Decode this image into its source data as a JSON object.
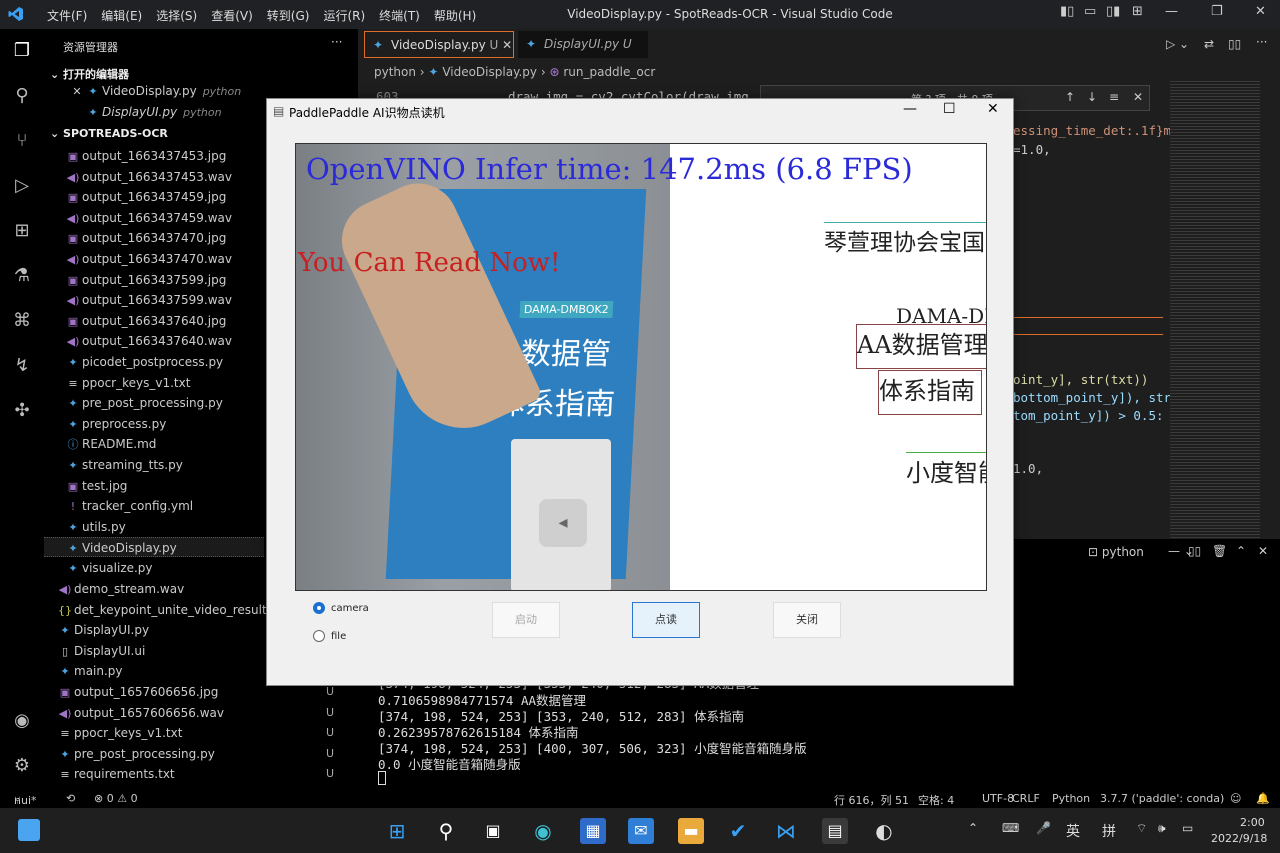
{
  "window": {
    "title": "VideoDisplay.py - SpotReads-OCR - Visual Studio Code",
    "menu": [
      "文件(F)",
      "编辑(E)",
      "选择(S)",
      "查看(V)",
      "转到(G)",
      "运行(R)",
      "终端(T)",
      "帮助(H)"
    ]
  },
  "sidebar": {
    "header": "资源管理器",
    "open_editors_title": "打开的编辑器",
    "open_editors": [
      {
        "name": "VideoDisplay.py",
        "lang": "python"
      },
      {
        "name": "DisplayUI.py",
        "lang": "python"
      }
    ],
    "project_title": "SPOTREADS-OCR",
    "files": [
      {
        "name": "output_1663437453.jpg",
        "icon": "image-icon"
      },
      {
        "name": "output_1663437453.wav",
        "icon": "audio-icon"
      },
      {
        "name": "output_1663437459.jpg",
        "icon": "image-icon"
      },
      {
        "name": "output_1663437459.wav",
        "icon": "audio-icon"
      },
      {
        "name": "output_1663437470.jpg",
        "icon": "image-icon"
      },
      {
        "name": "output_1663437470.wav",
        "icon": "audio-icon"
      },
      {
        "name": "output_1663437599.jpg",
        "icon": "image-icon"
      },
      {
        "name": "output_1663437599.wav",
        "icon": "audio-icon"
      },
      {
        "name": "output_1663437640.jpg",
        "icon": "image-icon"
      },
      {
        "name": "output_1663437640.wav",
        "icon": "audio-icon"
      },
      {
        "name": "picodet_postprocess.py",
        "icon": "python-icon"
      },
      {
        "name": "ppocr_keys_v1.txt",
        "icon": "text-icon"
      },
      {
        "name": "pre_post_processing.py",
        "icon": "python-icon"
      },
      {
        "name": "preprocess.py",
        "icon": "python-icon"
      },
      {
        "name": "README.md",
        "icon": "info-icon"
      },
      {
        "name": "streaming_tts.py",
        "icon": "python-icon"
      },
      {
        "name": "test.jpg",
        "icon": "image-icon"
      },
      {
        "name": "tracker_config.yml",
        "icon": "yaml-icon"
      },
      {
        "name": "utils.py",
        "icon": "python-icon"
      },
      {
        "name": "VideoDisplay.py",
        "icon": "python-icon"
      },
      {
        "name": "visualize.py",
        "icon": "python-icon"
      }
    ],
    "outer_files": [
      {
        "name": "demo_stream.wav",
        "icon": "audio-icon",
        "badge": ""
      },
      {
        "name": "det_keypoint_unite_video_results.json",
        "icon": "json-icon",
        "badge": ""
      },
      {
        "name": "DisplayUI.py",
        "icon": "python-icon",
        "badge": ""
      },
      {
        "name": "DisplayUI.ui",
        "icon": "ui-icon",
        "badge": ""
      },
      {
        "name": "main.py",
        "icon": "python-icon",
        "badge": ""
      },
      {
        "name": "output_1657606656.jpg",
        "icon": "image-icon",
        "badge": "U"
      },
      {
        "name": "output_1657606656.wav",
        "icon": "audio-icon",
        "badge": "U"
      },
      {
        "name": "ppocr_keys_v1.txt",
        "icon": "text-icon",
        "badge": "U"
      },
      {
        "name": "pre_post_processing.py",
        "icon": "python-icon",
        "badge": "U"
      },
      {
        "name": "requirements.txt",
        "icon": "text-icon",
        "badge": "U"
      }
    ]
  },
  "editor": {
    "tabs": [
      {
        "label": "VideoDisplay.py",
        "badge": "U"
      },
      {
        "label": "DisplayUI.py",
        "badge": "U"
      }
    ],
    "breadcrumb": [
      "python",
      "VideoDisplay.py",
      "run_paddle_ocr"
    ],
    "find_result": "第 ? 项，共 0 项",
    "code_lines": [
      {
        "num": "603",
        "text": "draw_img = cv2.cvtColor(draw_img,"
      },
      {
        "num": "",
        "text": "essing_time_det:.1f}m"
      },
      {
        "num": "",
        "text": "=1.0,"
      },
      {
        "num": "",
        "text": "oint_y], str(txt))"
      },
      {
        "num": "",
        "text": "bottom_point_y]), str"
      },
      {
        "num": "",
        "text": "tom_point_y]) > 0.5:"
      },
      {
        "num": "",
        "text": "1.0,"
      }
    ]
  },
  "panel": {
    "terminal_label": "python",
    "lines": [
      "[374, 198, 524, 253] [353, 240, 512, 283] AA数据管理",
      "0.7106598984771574 AA数据管理",
      "[374, 198, 524, 253] [353, 240, 512, 283] 体系指南",
      "0.26239578762615184 体系指南",
      "[374, 198, 524, 253] [400, 307, 506, 323] 小度智能音箱随身版",
      "0.0 小度智能音箱随身版"
    ]
  },
  "statusbar": {
    "branch": "nui*",
    "problems": "⊗ 0 ⚠ 0",
    "position": "行 616，列 51",
    "indent": "空格: 4",
    "encoding": "UTF-8",
    "eol": "CRLF",
    "language": "Python",
    "interpreter": "3.7.7 ('paddle': conda)"
  },
  "taskbar": {
    "time": "2:00",
    "date": "2022/9/18",
    "ime": "英",
    "ime2": "拼"
  },
  "dialog": {
    "title": "PaddlePaddle AI识物点读机",
    "infer_text": "OpenVINO Infer time: 147.2ms (6.8 FPS)",
    "read_text": "You Can Read Now!",
    "ocr_texts": [
      "琴萱理协会宝国会编",
      "DAMA-DMBOK",
      "AA数据管理",
      "体系指南",
      "小度智能"
    ],
    "book_texts": [
      "DAMA-DMBOK2",
      "AA数据管理",
      "体系指南"
    ],
    "radio_camera": "camera",
    "radio_file": "file",
    "btn_start": "启动",
    "btn_read": "点读",
    "btn_close": "关闭"
  }
}
